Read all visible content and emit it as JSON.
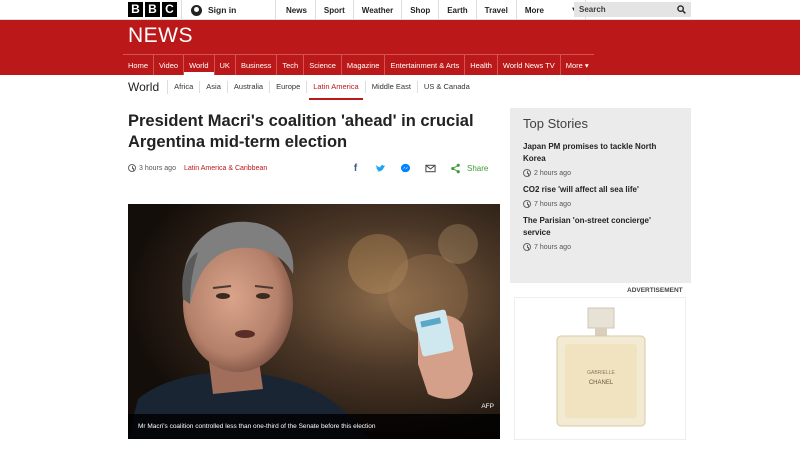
{
  "topbar": {
    "logo_letters": [
      "B",
      "B",
      "C"
    ],
    "signin": "Sign in",
    "nav": [
      "News",
      "Sport",
      "Weather",
      "Shop",
      "Earth",
      "Travel",
      "More"
    ],
    "search_placeholder": "Search"
  },
  "banner": {
    "title": "NEWS",
    "nav": [
      {
        "label": "Home",
        "active": false
      },
      {
        "label": "Video",
        "active": false
      },
      {
        "label": "World",
        "active": true
      },
      {
        "label": "UK",
        "active": false
      },
      {
        "label": "Business",
        "active": false
      },
      {
        "label": "Tech",
        "active": false
      },
      {
        "label": "Science",
        "active": false
      },
      {
        "label": "Magazine",
        "active": false
      },
      {
        "label": "Entertainment & Arts",
        "active": false
      },
      {
        "label": "Health",
        "active": false
      },
      {
        "label": "World News TV",
        "active": false
      },
      {
        "label": "More ▾",
        "active": false
      }
    ]
  },
  "subnav": {
    "section": "World",
    "items": [
      {
        "label": "Africa",
        "active": false
      },
      {
        "label": "Asia",
        "active": false
      },
      {
        "label": "Australia",
        "active": false
      },
      {
        "label": "Europe",
        "active": false
      },
      {
        "label": "Latin America",
        "active": true
      },
      {
        "label": "Middle East",
        "active": false
      },
      {
        "label": "US & Canada",
        "active": false
      }
    ]
  },
  "article": {
    "headline": "President Macri's coalition 'ahead' in crucial Argentina mid-term election",
    "time": "3 hours ago",
    "category": "Latin America & Caribbean",
    "share_label": "Share",
    "image_credit": "AFP",
    "caption": "Mr Macri's coalition controlled less than one-third of the Senate before this election"
  },
  "top_stories": {
    "title": "Top Stories",
    "items": [
      {
        "headline": "Japan PM promises to tackle North Korea",
        "time": "2 hours ago"
      },
      {
        "headline": "CO2 rise 'will affect all sea life'",
        "time": "7 hours ago"
      },
      {
        "headline": "The Parisian 'on-street concierge' service",
        "time": "7 hours ago"
      }
    ]
  },
  "advert": {
    "label": "ADVERTISEMENT",
    "brand_text": "CHANEL",
    "product_text": "GABRIELLE"
  },
  "colors": {
    "brand_red": "#bb1919",
    "share_green": "#3d9c36"
  }
}
